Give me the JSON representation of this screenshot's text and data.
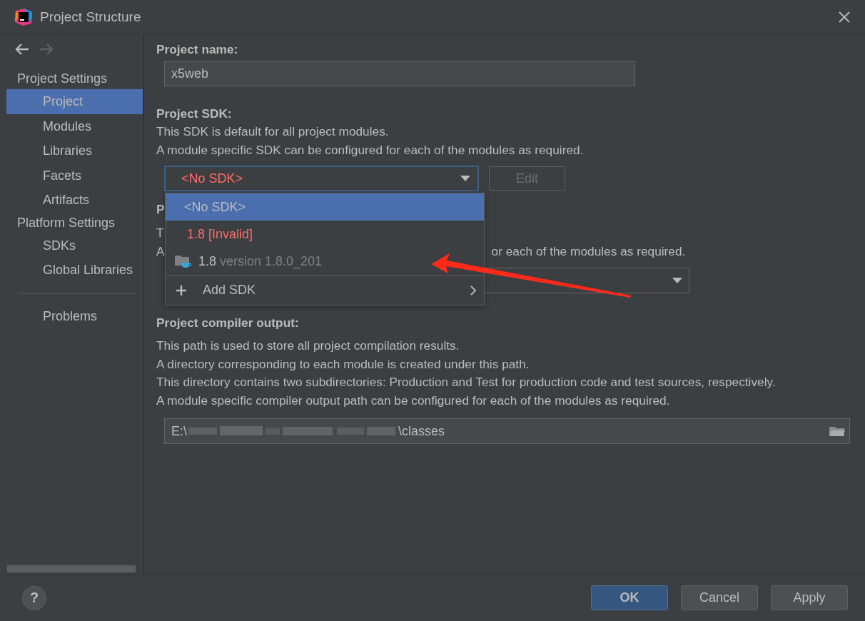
{
  "window": {
    "title": "Project Structure"
  },
  "nav_buttons": [
    {
      "kind": "back",
      "disabled": false
    },
    {
      "kind": "forward",
      "disabled": true
    }
  ],
  "sidebar": {
    "items": [
      {
        "kind": "header",
        "label": "Project Settings"
      },
      {
        "kind": "item",
        "label": "Project",
        "selected": true
      },
      {
        "kind": "item",
        "label": "Modules",
        "selected": false
      },
      {
        "kind": "item",
        "label": "Libraries",
        "selected": false
      },
      {
        "kind": "item",
        "label": "Facets",
        "selected": false
      },
      {
        "kind": "item",
        "label": "Artifacts",
        "selected": false
      },
      {
        "kind": "header",
        "label": "Platform Settings"
      },
      {
        "kind": "item",
        "label": "SDKs",
        "selected": false
      },
      {
        "kind": "item",
        "label": "Global Libraries",
        "selected": false
      },
      {
        "kind": "separator"
      },
      {
        "kind": "item",
        "label": "Problems",
        "selected": false
      }
    ]
  },
  "project_name": {
    "label": "Project name:",
    "value": "x5web"
  },
  "project_sdk": {
    "label": "Project SDK:",
    "description": [
      "This SDK is default for all project modules.",
      "A module specific SDK can be configured for each of the modules as required."
    ],
    "value": "<No SDK>",
    "invalid": true,
    "expanded": true,
    "edit_button": {
      "label": "Edit",
      "disabled": true
    }
  },
  "sdk_popup": {
    "items": [
      {
        "kind": "option",
        "label": "<No SDK>",
        "selected": true
      },
      {
        "kind": "invalid",
        "label": "1.8 [Invalid]",
        "selected": false
      },
      {
        "kind": "jdk",
        "name": "1.8",
        "detail": "version 1.8.0_201",
        "selected": false
      },
      {
        "kind": "action",
        "label": "Add SDK",
        "selected": false
      }
    ]
  },
  "language_level": {
    "heading": "P",
    "lines": [
      {
        "text": "T"
      },
      {
        "text": "A",
        "tail": "or each of the modules as required."
      }
    ]
  },
  "compiler_output": {
    "label": "Project compiler output:",
    "description": [
      "This path is used to store all project compilation results.",
      "A directory corresponding to each module is created under this path.",
      "This directory contains two subdirectories: Production and Test for production code and test sources, respectively.",
      "A module specific compiler output path can be configured for each of the modules as required."
    ],
    "path_start": "E:\\",
    "path_end": "\\classes",
    "redacted": true
  },
  "footer": {
    "help": "?",
    "buttons": [
      {
        "label": "OK",
        "default": true
      },
      {
        "label": "Cancel",
        "default": false
      },
      {
        "label": "Apply",
        "default": false
      }
    ]
  },
  "annotation": {
    "arrow": true
  }
}
